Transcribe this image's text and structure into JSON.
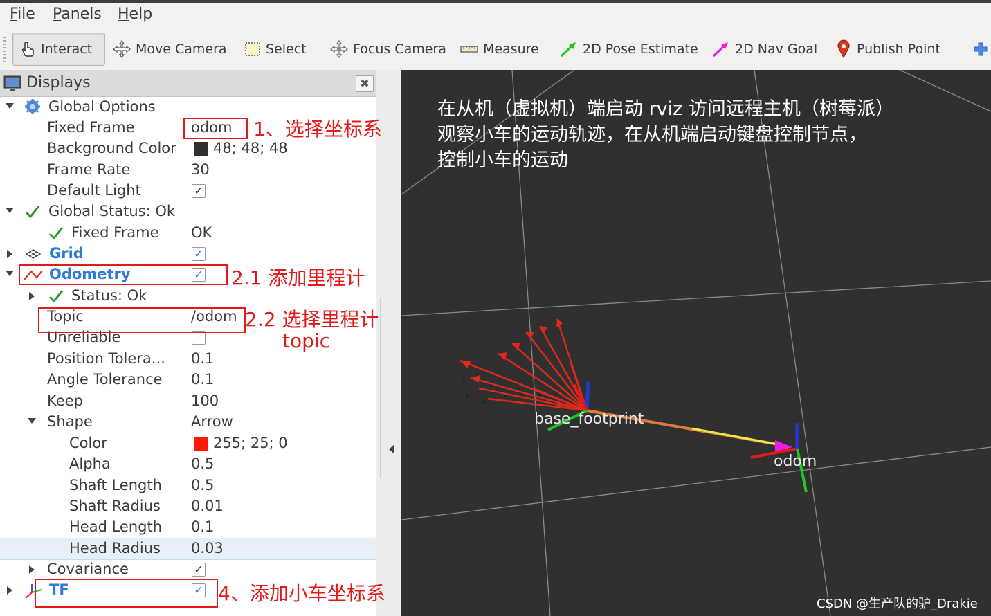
{
  "menu": [
    "File",
    "Panels",
    "Help"
  ],
  "toolbar": {
    "tools": [
      {
        "label": "Interact",
        "icon": "interact-hand-icon"
      },
      {
        "label": "Move Camera",
        "icon": "move-camera-icon"
      },
      {
        "label": "Select",
        "icon": "select-box-icon"
      },
      {
        "label": "Focus Camera",
        "icon": "focus-camera-icon"
      },
      {
        "label": "Measure",
        "icon": "measure-ruler-icon"
      },
      {
        "label": "2D Pose Estimate",
        "icon": "pose-estimate-arrow-icon"
      },
      {
        "label": "2D Nav Goal",
        "icon": "nav-goal-arrow-icon"
      },
      {
        "label": "Publish Point",
        "icon": "publish-point-pin-icon"
      }
    ],
    "active_tool": "Interact"
  },
  "displays": {
    "title": "Displays",
    "close_glyph": "✖",
    "rows": {
      "global_options": {
        "label": "Global Options"
      },
      "fixed_frame": {
        "label": "Fixed Frame",
        "value": "odom"
      },
      "background_color": {
        "label": "Background Color",
        "value": "48; 48; 48",
        "color": "#303030"
      },
      "frame_rate": {
        "label": "Frame Rate",
        "value": "30"
      },
      "default_light": {
        "label": "Default Light",
        "checked": true
      },
      "global_status": {
        "label": "Global Status: Ok"
      },
      "status_fixed_frame": {
        "label": "Fixed Frame",
        "value": "OK"
      },
      "grid": {
        "label": "Grid",
        "checked": true
      },
      "odometry": {
        "label": "Odometry",
        "checked": true
      },
      "odom_status": {
        "label": "Status: Ok"
      },
      "topic": {
        "label": "Topic",
        "value": "/odom"
      },
      "unreliable": {
        "label": "Unreliable",
        "checked": false
      },
      "position_tolerance": {
        "label": "Position Tolera...",
        "value": "0.1"
      },
      "angle_tolerance": {
        "label": "Angle Tolerance",
        "value": "0.1"
      },
      "keep": {
        "label": "Keep",
        "value": "100"
      },
      "shape": {
        "label": "Shape",
        "value": "Arrow"
      },
      "color": {
        "label": "Color",
        "value": "255; 25; 0",
        "color": "#ff1900"
      },
      "alpha": {
        "label": "Alpha",
        "value": "0.5"
      },
      "shaft_length": {
        "label": "Shaft Length",
        "value": "0.5"
      },
      "shaft_radius": {
        "label": "Shaft Radius",
        "value": "0.01"
      },
      "head_length": {
        "label": "Head Length",
        "value": "0.1"
      },
      "head_radius": {
        "label": "Head Radius",
        "value": "0.03"
      },
      "covariance": {
        "label": "Covariance",
        "checked": true
      },
      "tf": {
        "label": "TF",
        "checked": true
      }
    }
  },
  "viewport": {
    "note_lines": [
      "在从机（虚拟机）端启动 rviz 访问远程主机（树莓派）",
      "观察小车的运动轨迹，在从机端启动键盘控制节点，",
      "控制小车的运动"
    ],
    "frames": {
      "base": "base_footprint",
      "odom": "odom"
    },
    "background_color": "#303030"
  },
  "annotations": {
    "step1": "1、选择坐标系",
    "step2_1": "2.1 添加里程计",
    "step2_2_line1": "2.2 选择里程计",
    "step2_2_line2": "topic",
    "step4": "4、添加小车坐标系"
  },
  "watermark": "CSDN @生产队的驴_Drakie"
}
